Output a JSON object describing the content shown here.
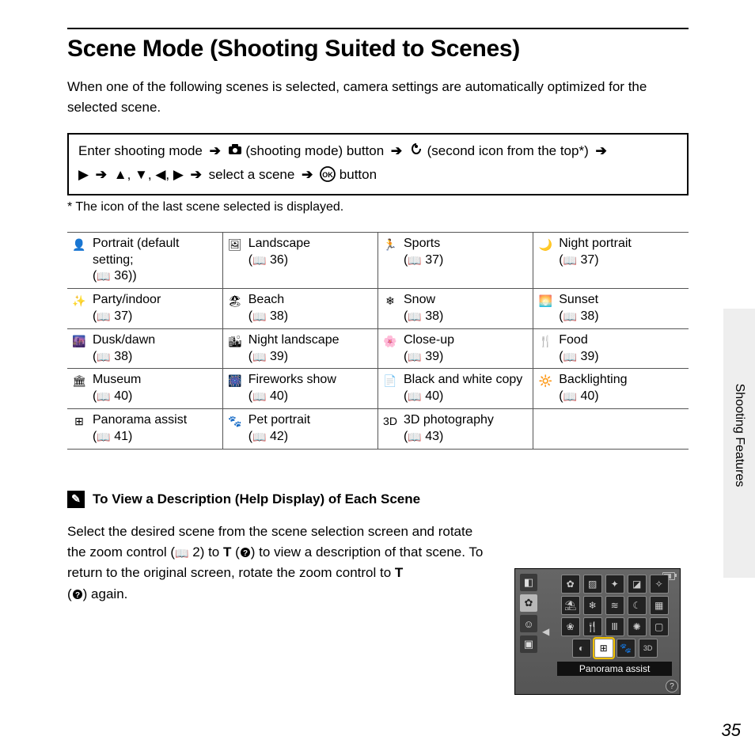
{
  "title": "Scene Mode (Shooting Suited to Scenes)",
  "intro": "When one of the following scenes is selected, camera settings are automatically optimized for the selected scene.",
  "nav": {
    "line1_a": "Enter shooting mode",
    "line1_b": "(shooting mode) button",
    "line1_c": "(second icon from the top*)",
    "line2_a": ",",
    "line2_b": "select a scene",
    "line2_c": "button"
  },
  "note": "*  The icon of the last scene selected is displayed.",
  "scenes": [
    [
      {
        "label": "Portrait (default setting;",
        "page": "36",
        "close": ")"
      },
      {
        "label": "Landscape",
        "page": "36"
      },
      {
        "label": "Sports",
        "page": "37"
      },
      {
        "label": "Night portrait",
        "page": "37"
      }
    ],
    [
      {
        "label": "Party/indoor",
        "page": "37"
      },
      {
        "label": "Beach",
        "page": "38"
      },
      {
        "label": "Snow",
        "page": "38"
      },
      {
        "label": "Sunset",
        "page": "38"
      }
    ],
    [
      {
        "label": "Dusk/dawn",
        "page": "38"
      },
      {
        "label": "Night landscape",
        "page": "39"
      },
      {
        "label": "Close-up",
        "page": "39"
      },
      {
        "label": "Food",
        "page": "39"
      }
    ],
    [
      {
        "label": "Museum",
        "page": "40"
      },
      {
        "label": "Fireworks show",
        "page": "40"
      },
      {
        "label": "Black and white copy",
        "page": "40"
      },
      {
        "label": "Backlighting",
        "page": "40"
      }
    ],
    [
      {
        "label": "Panorama assist",
        "page": "41"
      },
      {
        "label": "Pet portrait",
        "page": "42"
      },
      {
        "label": "3D photography",
        "page": "43"
      },
      {
        "label": "",
        "page": ""
      }
    ]
  ],
  "icons": [
    [
      "👤",
      "🖼",
      "🏃",
      "🌙"
    ],
    [
      "✨",
      "🏖",
      "❄",
      "🌅"
    ],
    [
      "🌆",
      "🏙",
      "🌸",
      "🍴"
    ],
    [
      "🏛",
      "🎆",
      "📄",
      "🔆"
    ],
    [
      "⊞",
      "🐾",
      "3D",
      ""
    ]
  ],
  "side_tab": "Shooting Features",
  "help": {
    "heading": "To View a Description (Help Display) of Each Scene",
    "body_a": "Select the desired scene from the scene selection screen and rotate the zoom control (",
    "body_page": "2",
    "body_b": ") to ",
    "body_c": " (",
    "body_d": ") to view a description of that scene. To return to the original screen, rotate the zoom control to ",
    "body_e": " (",
    "body_f": ") again."
  },
  "mini": {
    "caption": "Panorama assist"
  },
  "page_number": "35",
  "glyphs": {
    "T": "T"
  }
}
